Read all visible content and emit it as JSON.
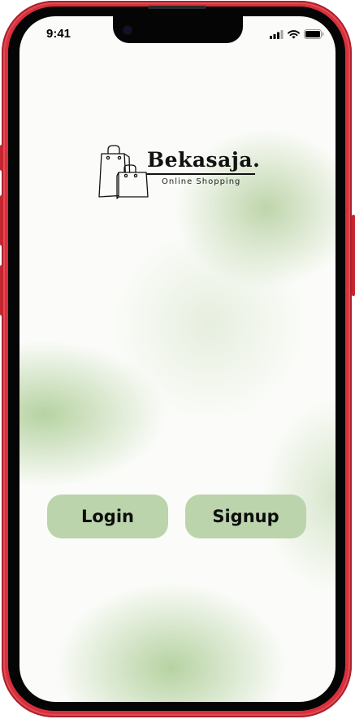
{
  "status_bar": {
    "time": "9:41",
    "icons": [
      "signal-bars-icon",
      "wifi-icon",
      "battery-icon"
    ]
  },
  "logo": {
    "brand_name": "Bekasaja.",
    "tagline": "Online Shopping",
    "icon": "shopping-bags-icon"
  },
  "buttons": {
    "login_label": "Login",
    "signup_label": "Signup"
  },
  "colors": {
    "button_fill": "#bcd4ac",
    "background_tint": "#a9c98f",
    "phone_frame": "#d8303c"
  }
}
